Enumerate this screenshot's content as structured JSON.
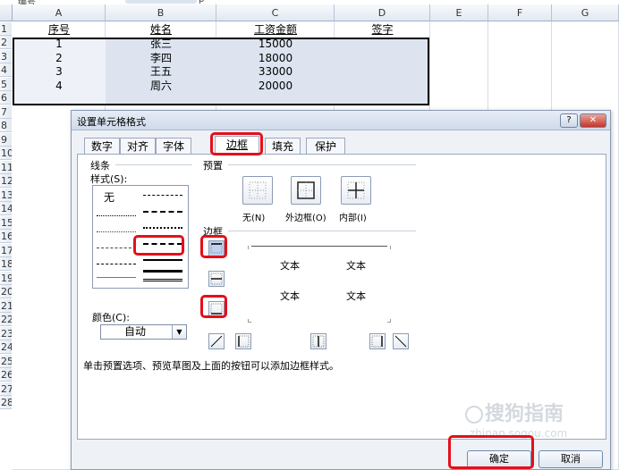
{
  "sheet": {
    "top_cut": {
      "left": "编号",
      "mid": "p"
    },
    "columns": [
      "A",
      "B",
      "C",
      "D",
      "E",
      "F",
      "G"
    ],
    "rows": [
      "1",
      "2",
      "3",
      "4",
      "5",
      "6",
      "7",
      "8",
      "9",
      "10",
      "11",
      "12",
      "13",
      "14",
      "15",
      "16",
      "17",
      "18",
      "19",
      "20",
      "21",
      "22",
      "23",
      "24",
      "25",
      "26",
      "27",
      "28"
    ],
    "header": [
      "序号",
      "姓名",
      "工资金额",
      "签字"
    ],
    "data": [
      [
        "1",
        "张三",
        "15000",
        ""
      ],
      [
        "2",
        "李四",
        "18000",
        ""
      ],
      [
        "3",
        "王五",
        "33000",
        ""
      ],
      [
        "4",
        "周六",
        "20000",
        ""
      ]
    ]
  },
  "dialog": {
    "title": "设置单元格格式",
    "help_label": "?",
    "close_label": "✕",
    "tabs": [
      "数字",
      "对齐",
      "字体",
      "边框",
      "填充",
      "保护"
    ],
    "active_tab": "边框",
    "line_group": "线条",
    "style_label": "样式(S):",
    "style_none": "无",
    "color_label": "颜色(C):",
    "color_value": "自动",
    "preset_group": "预置",
    "presets": [
      "无(N)",
      "外边框(O)",
      "内部(I)"
    ],
    "border_group": "边框",
    "preview_text": [
      "文本",
      "文本",
      "文本",
      "文本"
    ],
    "hint": "单击预置选项、预览草图及上面的按钮可以添加边框样式。",
    "ok_label": "确定",
    "cancel_label": "取消"
  },
  "watermark": {
    "text": "搜狗指南",
    "url": "zhinan.sogou.com"
  },
  "colors": {
    "accent_red": "#e3101b",
    "selection_fill": "#dde4f0",
    "header_bg": "#e3e9f2"
  }
}
